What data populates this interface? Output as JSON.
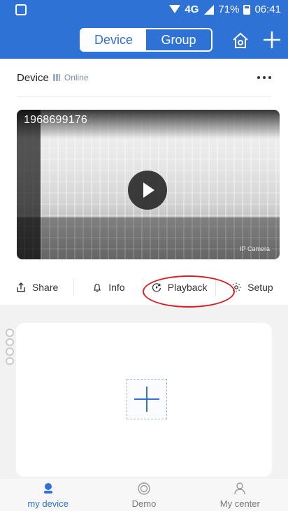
{
  "status_bar": {
    "network": "4G",
    "battery": "71%",
    "time": "06:41"
  },
  "header": {
    "tabs": [
      {
        "label": "Device",
        "active": true
      },
      {
        "label": "Group",
        "active": false
      }
    ]
  },
  "device_card": {
    "title": "Device",
    "status": "Online",
    "camera_id": "1968699176",
    "actions": [
      {
        "label": "Share"
      },
      {
        "label": "Info"
      },
      {
        "label": "Playback"
      },
      {
        "label": "Setup"
      }
    ],
    "highlight_color": "#d61f26"
  },
  "bottom_nav": {
    "items": [
      {
        "label": "my device",
        "active": true,
        "icon": "user-icon"
      },
      {
        "label": "Demo",
        "active": false,
        "icon": "demo-icon"
      },
      {
        "label": "My center",
        "active": false,
        "icon": "profile-icon"
      }
    ]
  },
  "colors": {
    "brand": "#2f72d6",
    "background": "#f2f2f2",
    "card": "#ffffff",
    "text": "#333333",
    "muted": "#777777"
  }
}
